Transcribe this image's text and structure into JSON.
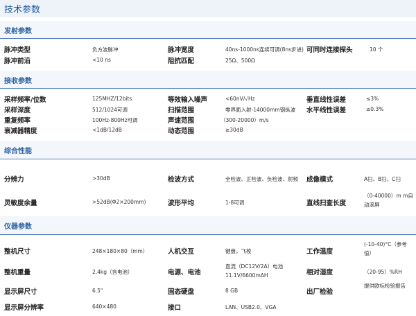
{
  "page_title": "技术参数",
  "sections": {
    "emit": {
      "title": "发射参数",
      "rows": [
        [
          "脉冲类型",
          "负方波脉冲",
          "脉冲宽度",
          "40ns-1000ns连续可调(8ns步进)",
          "可同时连接探头",
          "10 个"
        ],
        [
          "脉冲前沿",
          "<10 ns",
          "阻抗匹配",
          "25Ω、500Ω",
          "",
          ""
        ]
      ]
    },
    "receive": {
      "title": "接收参数",
      "rows": [
        [
          "采样频率/位数",
          "125MHZ/12bits",
          "等效输入噪声",
          "<60nV/√Hz",
          "垂直线性误差",
          "≤3%"
        ],
        [
          "采样深度",
          "512/1024可调",
          "扫描范围",
          "零界面入射-14000mm钢纵波",
          "水平线性误差",
          "≤0.3%"
        ],
        [
          "重复频率",
          "100Hz-800Hz可调",
          "声速范围",
          "（300-20000）m/s",
          "",
          ""
        ],
        [
          "衰减器精度",
          "<1dB/12dB",
          "动态范围",
          "≥30dB",
          "",
          ""
        ]
      ]
    },
    "overall": {
      "title": "综合性能",
      "rows": [
        [
          "分辨力",
          ">30dB",
          "检波方式",
          "全检波、正检波、负检波、射频",
          "成像模式",
          "A扫、B扫、C扫"
        ],
        [
          "灵敏度余量",
          ">52dB(Φ2×200mm)",
          "波形平均",
          "1-8可调",
          "直线扫查长度",
          "（0-40000）m m自动滚屏"
        ]
      ]
    },
    "instrument": {
      "title": "仪器参数",
      "rows": [
        [
          "整机尺寸",
          "248×180×80（mm）",
          "人机交互",
          "键盘，飞梭",
          "工作温度",
          "(-10-40)°C（参考值）"
        ],
        [
          "整机重量",
          "2.4kg（含电池）",
          "电源、电池",
          "直流（DC12V/2A）电池11.1V/6600mAH",
          "相对湿度",
          "（20-95）%RH"
        ],
        [
          "显示屏尺寸",
          "6.5\"",
          "固态硬盘",
          "8 GB",
          "出厂检验",
          "提供欧标检验报告"
        ],
        [
          "显示屏分辨率",
          "640×480",
          "接口",
          "LAN、USB2.0、VGA",
          "",
          ""
        ]
      ]
    }
  }
}
